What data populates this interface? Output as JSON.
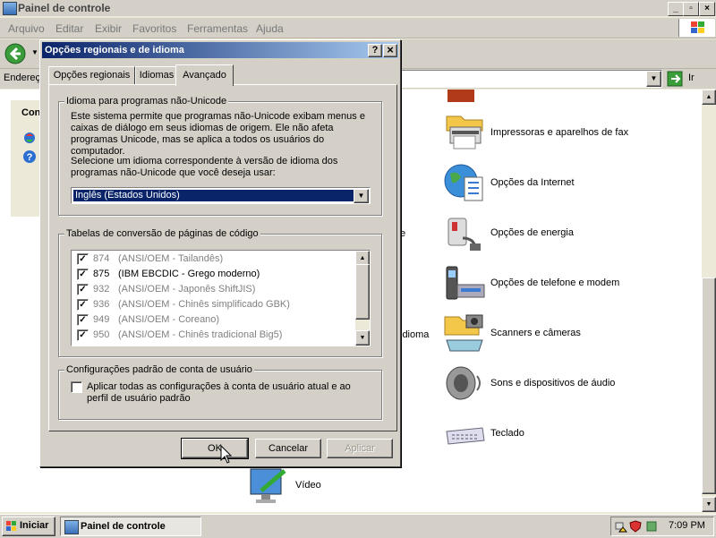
{
  "window": {
    "title": "Painel de controle",
    "controls": {
      "minimize": "_",
      "maximize": "▫",
      "close": "×"
    }
  },
  "menu": [
    "Arquivo",
    "Editar",
    "Exibir",
    "Favoritos",
    "Ferramentas",
    "Ajuda"
  ],
  "address": {
    "label": "Endereç",
    "go": "Ir"
  },
  "sidebar": {
    "heading": "Con"
  },
  "control_panel_items": [
    {
      "label": "Impressoras e aparelhos de fax",
      "icon": "printer-icon"
    },
    {
      "label": "Opções da Internet",
      "icon": "globe-icon"
    },
    {
      "label": "Opções de energia",
      "icon": "power-icon"
    },
    {
      "label": "Opções de telefone e modem",
      "icon": "phone-icon"
    },
    {
      "label": "Scanners e câmeras",
      "icon": "scanner-icon"
    },
    {
      "label": "Sons e dispositivos de áudio",
      "icon": "speaker-icon"
    },
    {
      "label": "Teclado",
      "icon": "keyboard-icon"
    }
  ],
  "partial_labels": {
    "idioma": "idioma",
    "video": "Vídeo",
    "e_char": "e"
  },
  "dialog": {
    "title": "Opções regionais e de idioma",
    "help": "?",
    "close": "×",
    "tabs": [
      "Opções regionais",
      "Idiomas",
      "Avançado"
    ],
    "active_tab": "Avançado",
    "group_unicode": {
      "legend": "Idioma para programas não-Unicode",
      "desc1": "Este sistema permite que programas não-Unicode exibam menus e caixas de diálogo em seus idiomas de origem. Ele não afeta programas Unicode, mas se aplica a todos os usuários do computador.",
      "desc2": "Selecione um idioma correspondente à versão de idioma dos programas não-Unicode que você deseja usar:",
      "selected_language": "Inglês (Estados Unidos)"
    },
    "group_codepages": {
      "legend": "Tabelas de conversão de páginas de código",
      "rows": [
        {
          "code": "874",
          "desc": "(ANSI/OEM - Tailandês)",
          "checked": true,
          "dim": true
        },
        {
          "code": "875",
          "desc": "(IBM EBCDIC - Grego moderno)",
          "checked": true,
          "dim": false
        },
        {
          "code": "932",
          "desc": "(ANSI/OEM - Japonês ShiftJIS)",
          "checked": true,
          "dim": true
        },
        {
          "code": "936",
          "desc": "(ANSI/OEM - Chinês simplificado GBK)",
          "checked": true,
          "dim": true
        },
        {
          "code": "949",
          "desc": "(ANSI/OEM - Coreano)",
          "checked": true,
          "dim": true
        },
        {
          "code": "950",
          "desc": "(ANSI/OEM - Chinês tradicional Big5)",
          "checked": true,
          "dim": true
        }
      ]
    },
    "group_user": {
      "legend": "Configurações padrão de conta de usuário",
      "checkbox_label": "Aplicar todas as configurações à conta de usuário atual e ao perfil de usuário padrão",
      "checked": false
    },
    "buttons": {
      "ok": "OK",
      "cancel": "Cancelar",
      "apply": "Aplicar"
    }
  },
  "taskbar": {
    "start": "Iniciar",
    "task": "Painel de controle",
    "clock": "7:09 PM"
  },
  "colors": {
    "titlebar_active": "#0A246A",
    "selection": "#0A246A",
    "face": "#D4D0C8"
  }
}
